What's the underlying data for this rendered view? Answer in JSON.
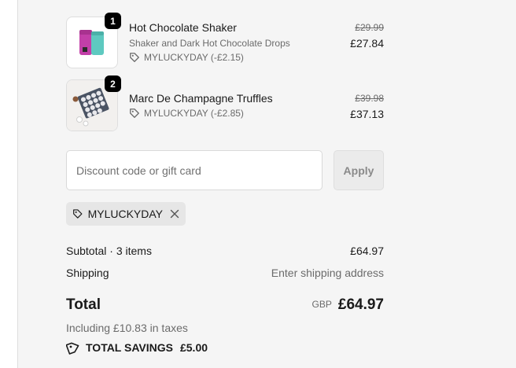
{
  "line_items": [
    {
      "quantity": "1",
      "title": "Hot Chocolate Shaker",
      "subtitle": "Shaker and Dark Hot Chocolate Drops",
      "discount": "MYLUCKYDAY (-£2.15)",
      "original_price": "£29.99",
      "price": "£27.84",
      "thumbnail_icon": "pink-and-teal-shaker-bottles-image"
    },
    {
      "quantity": "2",
      "title": "Marc De Champagne Truffles",
      "discount": "MYLUCKYDAY (-£2.85)",
      "original_price": "£39.98",
      "price": "£37.13",
      "thumbnail_icon": "truffle-box-image"
    }
  ],
  "discount": {
    "placeholder": "Discount code or gift card",
    "apply_label": "Apply",
    "applied_code": "MYLUCKYDAY"
  },
  "summary": {
    "subtotal_label": "Subtotal · 3 items",
    "subtotal_value": "£64.97",
    "shipping_label": "Shipping",
    "shipping_value": "Enter shipping address",
    "total_label": "Total",
    "total_currency": "GBP",
    "total_value": "£64.97",
    "taxes_note": "Including £10.83 in taxes",
    "savings_label": "TOTAL SAVINGS",
    "savings_value": "£5.00"
  },
  "colors": {
    "panel_background": "#f5f5f5",
    "badge": "#000000",
    "muted_text": "#6b6b6b"
  }
}
